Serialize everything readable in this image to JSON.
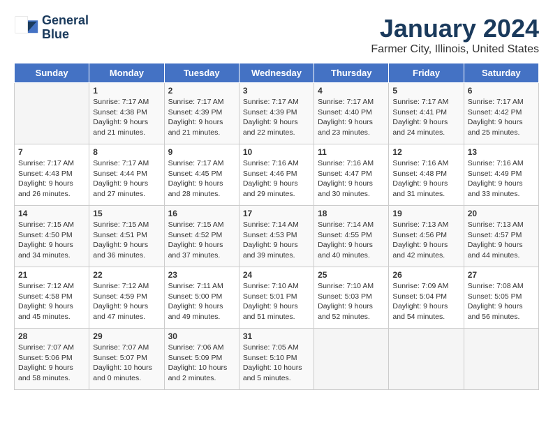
{
  "header": {
    "logo_line1": "General",
    "logo_line2": "Blue",
    "title": "January 2024",
    "subtitle": "Farmer City, Illinois, United States"
  },
  "weekdays": [
    "Sunday",
    "Monday",
    "Tuesday",
    "Wednesday",
    "Thursday",
    "Friday",
    "Saturday"
  ],
  "weeks": [
    [
      {
        "day": "",
        "sunrise": "",
        "sunset": "",
        "daylight": ""
      },
      {
        "day": "1",
        "sunrise": "Sunrise: 7:17 AM",
        "sunset": "Sunset: 4:38 PM",
        "daylight": "Daylight: 9 hours and 21 minutes."
      },
      {
        "day": "2",
        "sunrise": "Sunrise: 7:17 AM",
        "sunset": "Sunset: 4:39 PM",
        "daylight": "Daylight: 9 hours and 21 minutes."
      },
      {
        "day": "3",
        "sunrise": "Sunrise: 7:17 AM",
        "sunset": "Sunset: 4:39 PM",
        "daylight": "Daylight: 9 hours and 22 minutes."
      },
      {
        "day": "4",
        "sunrise": "Sunrise: 7:17 AM",
        "sunset": "Sunset: 4:40 PM",
        "daylight": "Daylight: 9 hours and 23 minutes."
      },
      {
        "day": "5",
        "sunrise": "Sunrise: 7:17 AM",
        "sunset": "Sunset: 4:41 PM",
        "daylight": "Daylight: 9 hours and 24 minutes."
      },
      {
        "day": "6",
        "sunrise": "Sunrise: 7:17 AM",
        "sunset": "Sunset: 4:42 PM",
        "daylight": "Daylight: 9 hours and 25 minutes."
      }
    ],
    [
      {
        "day": "7",
        "sunrise": "Sunrise: 7:17 AM",
        "sunset": "Sunset: 4:43 PM",
        "daylight": "Daylight: 9 hours and 26 minutes."
      },
      {
        "day": "8",
        "sunrise": "Sunrise: 7:17 AM",
        "sunset": "Sunset: 4:44 PM",
        "daylight": "Daylight: 9 hours and 27 minutes."
      },
      {
        "day": "9",
        "sunrise": "Sunrise: 7:17 AM",
        "sunset": "Sunset: 4:45 PM",
        "daylight": "Daylight: 9 hours and 28 minutes."
      },
      {
        "day": "10",
        "sunrise": "Sunrise: 7:16 AM",
        "sunset": "Sunset: 4:46 PM",
        "daylight": "Daylight: 9 hours and 29 minutes."
      },
      {
        "day": "11",
        "sunrise": "Sunrise: 7:16 AM",
        "sunset": "Sunset: 4:47 PM",
        "daylight": "Daylight: 9 hours and 30 minutes."
      },
      {
        "day": "12",
        "sunrise": "Sunrise: 7:16 AM",
        "sunset": "Sunset: 4:48 PM",
        "daylight": "Daylight: 9 hours and 31 minutes."
      },
      {
        "day": "13",
        "sunrise": "Sunrise: 7:16 AM",
        "sunset": "Sunset: 4:49 PM",
        "daylight": "Daylight: 9 hours and 33 minutes."
      }
    ],
    [
      {
        "day": "14",
        "sunrise": "Sunrise: 7:15 AM",
        "sunset": "Sunset: 4:50 PM",
        "daylight": "Daylight: 9 hours and 34 minutes."
      },
      {
        "day": "15",
        "sunrise": "Sunrise: 7:15 AM",
        "sunset": "Sunset: 4:51 PM",
        "daylight": "Daylight: 9 hours and 36 minutes."
      },
      {
        "day": "16",
        "sunrise": "Sunrise: 7:15 AM",
        "sunset": "Sunset: 4:52 PM",
        "daylight": "Daylight: 9 hours and 37 minutes."
      },
      {
        "day": "17",
        "sunrise": "Sunrise: 7:14 AM",
        "sunset": "Sunset: 4:53 PM",
        "daylight": "Daylight: 9 hours and 39 minutes."
      },
      {
        "day": "18",
        "sunrise": "Sunrise: 7:14 AM",
        "sunset": "Sunset: 4:55 PM",
        "daylight": "Daylight: 9 hours and 40 minutes."
      },
      {
        "day": "19",
        "sunrise": "Sunrise: 7:13 AM",
        "sunset": "Sunset: 4:56 PM",
        "daylight": "Daylight: 9 hours and 42 minutes."
      },
      {
        "day": "20",
        "sunrise": "Sunrise: 7:13 AM",
        "sunset": "Sunset: 4:57 PM",
        "daylight": "Daylight: 9 hours and 44 minutes."
      }
    ],
    [
      {
        "day": "21",
        "sunrise": "Sunrise: 7:12 AM",
        "sunset": "Sunset: 4:58 PM",
        "daylight": "Daylight: 9 hours and 45 minutes."
      },
      {
        "day": "22",
        "sunrise": "Sunrise: 7:12 AM",
        "sunset": "Sunset: 4:59 PM",
        "daylight": "Daylight: 9 hours and 47 minutes."
      },
      {
        "day": "23",
        "sunrise": "Sunrise: 7:11 AM",
        "sunset": "Sunset: 5:00 PM",
        "daylight": "Daylight: 9 hours and 49 minutes."
      },
      {
        "day": "24",
        "sunrise": "Sunrise: 7:10 AM",
        "sunset": "Sunset: 5:01 PM",
        "daylight": "Daylight: 9 hours and 51 minutes."
      },
      {
        "day": "25",
        "sunrise": "Sunrise: 7:10 AM",
        "sunset": "Sunset: 5:03 PM",
        "daylight": "Daylight: 9 hours and 52 minutes."
      },
      {
        "day": "26",
        "sunrise": "Sunrise: 7:09 AM",
        "sunset": "Sunset: 5:04 PM",
        "daylight": "Daylight: 9 hours and 54 minutes."
      },
      {
        "day": "27",
        "sunrise": "Sunrise: 7:08 AM",
        "sunset": "Sunset: 5:05 PM",
        "daylight": "Daylight: 9 hours and 56 minutes."
      }
    ],
    [
      {
        "day": "28",
        "sunrise": "Sunrise: 7:07 AM",
        "sunset": "Sunset: 5:06 PM",
        "daylight": "Daylight: 9 hours and 58 minutes."
      },
      {
        "day": "29",
        "sunrise": "Sunrise: 7:07 AM",
        "sunset": "Sunset: 5:07 PM",
        "daylight": "Daylight: 10 hours and 0 minutes."
      },
      {
        "day": "30",
        "sunrise": "Sunrise: 7:06 AM",
        "sunset": "Sunset: 5:09 PM",
        "daylight": "Daylight: 10 hours and 2 minutes."
      },
      {
        "day": "31",
        "sunrise": "Sunrise: 7:05 AM",
        "sunset": "Sunset: 5:10 PM",
        "daylight": "Daylight: 10 hours and 5 minutes."
      },
      {
        "day": "",
        "sunrise": "",
        "sunset": "",
        "daylight": ""
      },
      {
        "day": "",
        "sunrise": "",
        "sunset": "",
        "daylight": ""
      },
      {
        "day": "",
        "sunrise": "",
        "sunset": "",
        "daylight": ""
      }
    ]
  ]
}
